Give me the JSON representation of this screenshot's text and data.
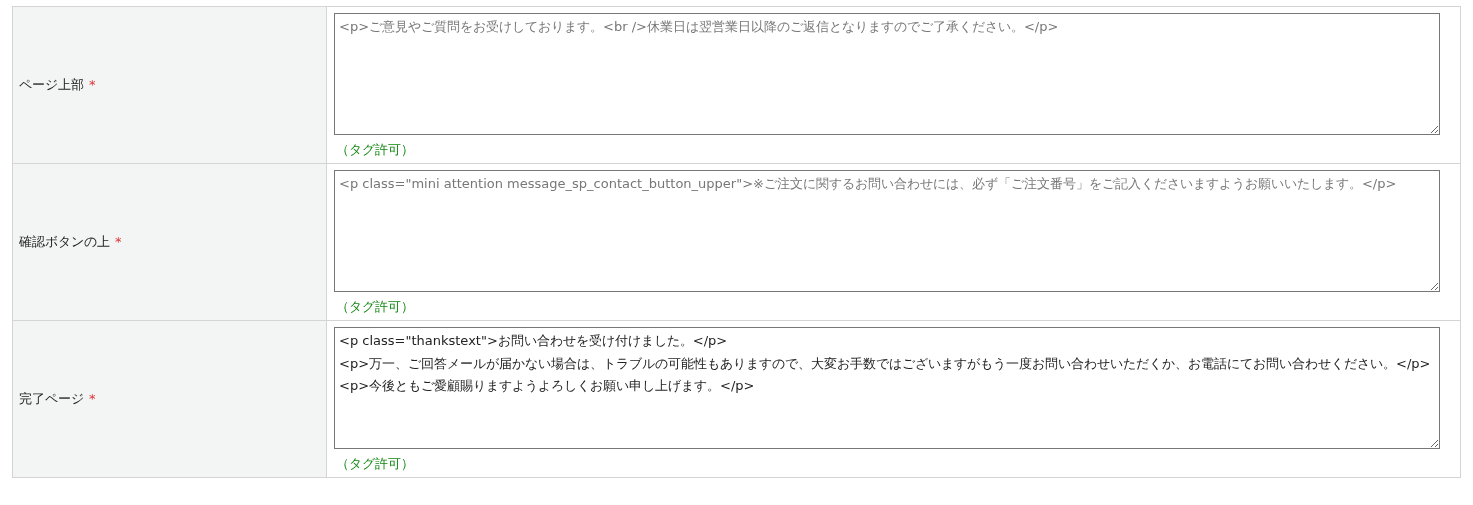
{
  "rows": [
    {
      "label": "ページ上部",
      "required_mark": "*",
      "placeholder": "<p>ご意見やご質問をお受けしております。<br />休業日は翌営業日以降のご返信となりますのでご了承ください。</p>",
      "note": "（タグ許可）"
    },
    {
      "label": "確認ボタンの上",
      "required_mark": "*",
      "placeholder": "<p class=\"mini attention message_sp_contact_button_upper\">※ご注文に関するお問い合わせには、必ず「ご注文番号」をご記入くださいますようお願いいたします。</p>",
      "note": "（タグ許可）"
    },
    {
      "label": "完了ページ",
      "required_mark": "*",
      "value": "<p class=\"thankstext\">お問い合わせを受け付けました。</p>\n<p>万一、ご回答メールが届かない場合は、トラブルの可能性もありますので、大変お手数ではございますがもう一度お問い合わせいただくか、お電話にてお問い合わせください。</p>\n<p>今後ともご愛顧賜りますようよろしくお願い申し上げます。</p>",
      "note": "（タグ許可）"
    }
  ]
}
